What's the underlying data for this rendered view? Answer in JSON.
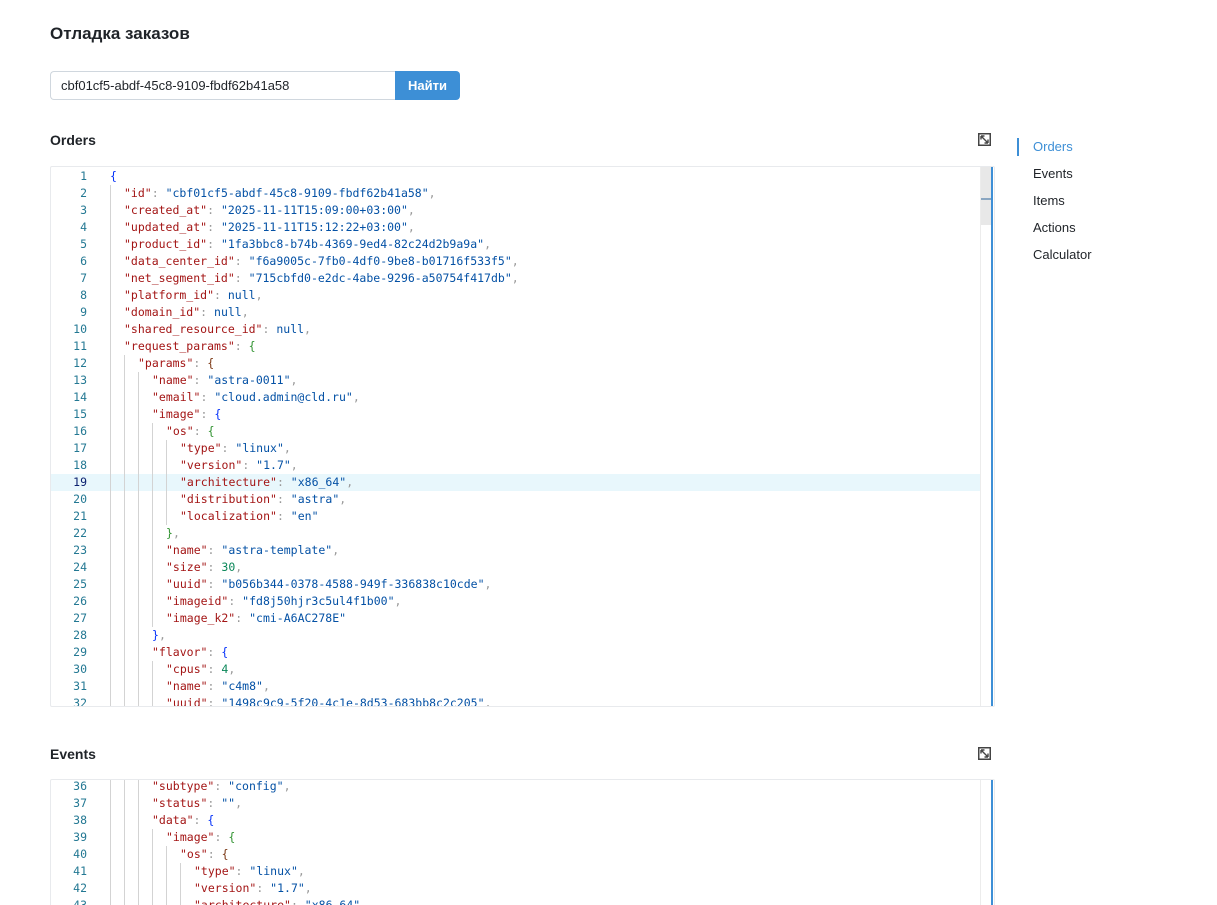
{
  "page_title": "Отладка заказов",
  "search": {
    "value": "cbf01cf5-abdf-45c8-9109-fbdf62b41a58",
    "button_label": "Найти"
  },
  "sections": {
    "orders": {
      "title": "Orders"
    },
    "events": {
      "title": "Events"
    }
  },
  "toc": {
    "items": [
      {
        "label": "Orders",
        "active": true
      },
      {
        "label": "Events",
        "active": false
      },
      {
        "label": "Items",
        "active": false
      },
      {
        "label": "Actions",
        "active": false
      },
      {
        "label": "Calculator",
        "active": false
      }
    ]
  },
  "orders_editor": {
    "active_line": 19,
    "lines": [
      {
        "n": 1,
        "indent": 0,
        "tokens": [
          [
            "b0",
            "{"
          ]
        ]
      },
      {
        "n": 2,
        "indent": 1,
        "tokens": [
          [
            "k",
            "\"id\""
          ],
          [
            "p",
            ": "
          ],
          [
            "s",
            "\"cbf01cf5-abdf-45c8-9109-fbdf62b41a58\""
          ],
          [
            "p",
            ","
          ]
        ]
      },
      {
        "n": 3,
        "indent": 1,
        "tokens": [
          [
            "k",
            "\"created_at\""
          ],
          [
            "p",
            ": "
          ],
          [
            "s",
            "\"2025-11-11T15:09:00+03:00\""
          ],
          [
            "p",
            ","
          ]
        ]
      },
      {
        "n": 4,
        "indent": 1,
        "tokens": [
          [
            "k",
            "\"updated_at\""
          ],
          [
            "p",
            ": "
          ],
          [
            "s",
            "\"2025-11-11T15:12:22+03:00\""
          ],
          [
            "p",
            ","
          ]
        ]
      },
      {
        "n": 5,
        "indent": 1,
        "tokens": [
          [
            "k",
            "\"product_id\""
          ],
          [
            "p",
            ": "
          ],
          [
            "s",
            "\"1fa3bbc8-b74b-4369-9ed4-82c24d2b9a9a\""
          ],
          [
            "p",
            ","
          ]
        ]
      },
      {
        "n": 6,
        "indent": 1,
        "tokens": [
          [
            "k",
            "\"data_center_id\""
          ],
          [
            "p",
            ": "
          ],
          [
            "s",
            "\"f6a9005c-7fb0-4df0-9be8-b01716f533f5\""
          ],
          [
            "p",
            ","
          ]
        ]
      },
      {
        "n": 7,
        "indent": 1,
        "tokens": [
          [
            "k",
            "\"net_segment_id\""
          ],
          [
            "p",
            ": "
          ],
          [
            "s",
            "\"715cbfd0-e2dc-4abe-9296-a50754f417db\""
          ],
          [
            "p",
            ","
          ]
        ]
      },
      {
        "n": 8,
        "indent": 1,
        "tokens": [
          [
            "k",
            "\"platform_id\""
          ],
          [
            "p",
            ": "
          ],
          [
            "n",
            "null"
          ],
          [
            "p",
            ","
          ]
        ]
      },
      {
        "n": 9,
        "indent": 1,
        "tokens": [
          [
            "k",
            "\"domain_id\""
          ],
          [
            "p",
            ": "
          ],
          [
            "n",
            "null"
          ],
          [
            "p",
            ","
          ]
        ]
      },
      {
        "n": 10,
        "indent": 1,
        "tokens": [
          [
            "k",
            "\"shared_resource_id\""
          ],
          [
            "p",
            ": "
          ],
          [
            "n",
            "null"
          ],
          [
            "p",
            ","
          ]
        ]
      },
      {
        "n": 11,
        "indent": 1,
        "tokens": [
          [
            "k",
            "\"request_params\""
          ],
          [
            "p",
            ": "
          ],
          [
            "b1",
            "{"
          ]
        ]
      },
      {
        "n": 12,
        "indent": 2,
        "tokens": [
          [
            "k",
            "\"params\""
          ],
          [
            "p",
            ": "
          ],
          [
            "b2",
            "{"
          ]
        ]
      },
      {
        "n": 13,
        "indent": 3,
        "tokens": [
          [
            "k",
            "\"name\""
          ],
          [
            "p",
            ": "
          ],
          [
            "s",
            "\"astra-0011\""
          ],
          [
            "p",
            ","
          ]
        ]
      },
      {
        "n": 14,
        "indent": 3,
        "tokens": [
          [
            "k",
            "\"email\""
          ],
          [
            "p",
            ": "
          ],
          [
            "s",
            "\"cloud.admin@cld.ru\""
          ],
          [
            "p",
            ","
          ]
        ]
      },
      {
        "n": 15,
        "indent": 3,
        "tokens": [
          [
            "k",
            "\"image\""
          ],
          [
            "p",
            ": "
          ],
          [
            "b0",
            "{"
          ]
        ]
      },
      {
        "n": 16,
        "indent": 4,
        "tokens": [
          [
            "k",
            "\"os\""
          ],
          [
            "p",
            ": "
          ],
          [
            "b1",
            "{"
          ]
        ]
      },
      {
        "n": 17,
        "indent": 5,
        "tokens": [
          [
            "k",
            "\"type\""
          ],
          [
            "p",
            ": "
          ],
          [
            "s",
            "\"linux\""
          ],
          [
            "p",
            ","
          ]
        ]
      },
      {
        "n": 18,
        "indent": 5,
        "tokens": [
          [
            "k",
            "\"version\""
          ],
          [
            "p",
            ": "
          ],
          [
            "s",
            "\"1.7\""
          ],
          [
            "p",
            ","
          ]
        ]
      },
      {
        "n": 19,
        "indent": 5,
        "tokens": [
          [
            "k",
            "\"architecture\""
          ],
          [
            "p",
            ": "
          ],
          [
            "s",
            "\"x86_64\""
          ],
          [
            "p",
            ","
          ]
        ]
      },
      {
        "n": 20,
        "indent": 5,
        "tokens": [
          [
            "k",
            "\"distribution\""
          ],
          [
            "p",
            ": "
          ],
          [
            "s",
            "\"astra\""
          ],
          [
            "p",
            ","
          ]
        ]
      },
      {
        "n": 21,
        "indent": 5,
        "tokens": [
          [
            "k",
            "\"localization\""
          ],
          [
            "p",
            ": "
          ],
          [
            "s",
            "\"en\""
          ]
        ]
      },
      {
        "n": 22,
        "indent": 4,
        "tokens": [
          [
            "b1",
            "}"
          ],
          [
            "p",
            ","
          ]
        ]
      },
      {
        "n": 23,
        "indent": 4,
        "tokens": [
          [
            "k",
            "\"name\""
          ],
          [
            "p",
            ": "
          ],
          [
            "s",
            "\"astra-template\""
          ],
          [
            "p",
            ","
          ]
        ]
      },
      {
        "n": 24,
        "indent": 4,
        "tokens": [
          [
            "k",
            "\"size\""
          ],
          [
            "p",
            ": "
          ],
          [
            "num",
            "30"
          ],
          [
            "p",
            ","
          ]
        ]
      },
      {
        "n": 25,
        "indent": 4,
        "tokens": [
          [
            "k",
            "\"uuid\""
          ],
          [
            "p",
            ": "
          ],
          [
            "s",
            "\"b056b344-0378-4588-949f-336838c10cde\""
          ],
          [
            "p",
            ","
          ]
        ]
      },
      {
        "n": 26,
        "indent": 4,
        "tokens": [
          [
            "k",
            "\"imageid\""
          ],
          [
            "p",
            ": "
          ],
          [
            "s",
            "\"fd8j50hjr3c5ul4f1b00\""
          ],
          [
            "p",
            ","
          ]
        ]
      },
      {
        "n": 27,
        "indent": 4,
        "tokens": [
          [
            "k",
            "\"image_k2\""
          ],
          [
            "p",
            ": "
          ],
          [
            "s",
            "\"cmi-A6AC278E\""
          ]
        ]
      },
      {
        "n": 28,
        "indent": 3,
        "tokens": [
          [
            "b0",
            "}"
          ],
          [
            "p",
            ","
          ]
        ]
      },
      {
        "n": 29,
        "indent": 3,
        "tokens": [
          [
            "k",
            "\"flavor\""
          ],
          [
            "p",
            ": "
          ],
          [
            "b0",
            "{"
          ]
        ]
      },
      {
        "n": 30,
        "indent": 4,
        "tokens": [
          [
            "k",
            "\"cpus\""
          ],
          [
            "p",
            ": "
          ],
          [
            "num",
            "4"
          ],
          [
            "p",
            ","
          ]
        ]
      },
      {
        "n": 31,
        "indent": 4,
        "tokens": [
          [
            "k",
            "\"name\""
          ],
          [
            "p",
            ": "
          ],
          [
            "s",
            "\"c4m8\""
          ],
          [
            "p",
            ","
          ]
        ]
      },
      {
        "n": 32,
        "indent": 4,
        "tokens": [
          [
            "k",
            "\"uuid\""
          ],
          [
            "p",
            ": "
          ],
          [
            "s",
            "\"1498c9c9-5f20-4c1e-8d53-683bb8c2c205\""
          ],
          [
            "p",
            ","
          ]
        ]
      }
    ]
  },
  "events_editor": {
    "active_line": 0,
    "lines": [
      {
        "n": 36,
        "indent": 3,
        "tokens": [
          [
            "k",
            "\"subtype\""
          ],
          [
            "p",
            ": "
          ],
          [
            "s",
            "\"config\""
          ],
          [
            "p",
            ","
          ]
        ]
      },
      {
        "n": 37,
        "indent": 3,
        "tokens": [
          [
            "k",
            "\"status\""
          ],
          [
            "p",
            ": "
          ],
          [
            "s",
            "\"\""
          ],
          [
            "p",
            ","
          ]
        ]
      },
      {
        "n": 38,
        "indent": 3,
        "tokens": [
          [
            "k",
            "\"data\""
          ],
          [
            "p",
            ": "
          ],
          [
            "b0",
            "{"
          ]
        ]
      },
      {
        "n": 39,
        "indent": 4,
        "tokens": [
          [
            "k",
            "\"image\""
          ],
          [
            "p",
            ": "
          ],
          [
            "b1",
            "{"
          ]
        ]
      },
      {
        "n": 40,
        "indent": 5,
        "tokens": [
          [
            "k",
            "\"os\""
          ],
          [
            "p",
            ": "
          ],
          [
            "b2",
            "{"
          ]
        ]
      },
      {
        "n": 41,
        "indent": 6,
        "tokens": [
          [
            "k",
            "\"type\""
          ],
          [
            "p",
            ": "
          ],
          [
            "s",
            "\"linux\""
          ],
          [
            "p",
            ","
          ]
        ]
      },
      {
        "n": 42,
        "indent": 6,
        "tokens": [
          [
            "k",
            "\"version\""
          ],
          [
            "p",
            ": "
          ],
          [
            "s",
            "\"1.7\""
          ],
          [
            "p",
            ","
          ]
        ]
      },
      {
        "n": 43,
        "indent": 6,
        "tokens": [
          [
            "k",
            "\"architecture\""
          ],
          [
            "p",
            ": "
          ],
          [
            "s",
            "\"x86_64\""
          ],
          [
            "p",
            ","
          ]
        ]
      }
    ]
  }
}
